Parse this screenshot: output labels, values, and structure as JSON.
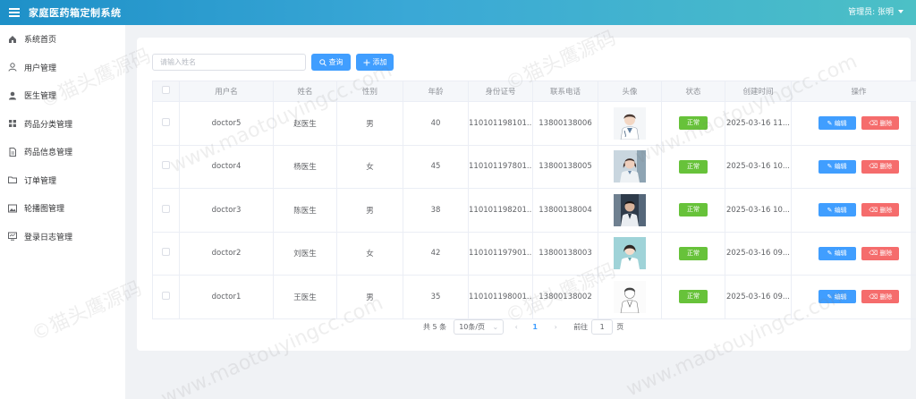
{
  "header": {
    "title": "家庭医药箱定制系统",
    "user_label": "管理员: 张明"
  },
  "sidebar": {
    "items": [
      {
        "label": "系统首页",
        "icon": "home-icon"
      },
      {
        "label": "用户管理",
        "icon": "user-outline-icon"
      },
      {
        "label": "医生管理",
        "icon": "user-filled-icon"
      },
      {
        "label": "药品分类管理",
        "icon": "grid-icon"
      },
      {
        "label": "药品信息管理",
        "icon": "document-icon"
      },
      {
        "label": "订单管理",
        "icon": "folder-icon"
      },
      {
        "label": "轮播图管理",
        "icon": "picture-icon"
      },
      {
        "label": "登录日志管理",
        "icon": "monitor-icon"
      }
    ]
  },
  "toolbar": {
    "search_placeholder": "请输入姓名",
    "query_label": "查询",
    "add_label": "添加"
  },
  "table": {
    "columns": [
      "用户名",
      "姓名",
      "性别",
      "年龄",
      "身份证号",
      "联系电话",
      "头像",
      "状态",
      "创建时间",
      "操作"
    ],
    "edit_label": "编辑",
    "delete_label": "删除",
    "rows": [
      {
        "username": "doctor5",
        "name": "赵医生",
        "gender": "男",
        "age": "40",
        "id_card": "110101198101...",
        "phone": "13800138006",
        "avatar": "male-doctor-cartoon",
        "status": "正常",
        "created": "2025-03-16 11..."
      },
      {
        "username": "doctor4",
        "name": "杨医生",
        "gender": "女",
        "age": "45",
        "id_card": "110101197801...",
        "phone": "13800138005",
        "avatar": "female-doctor-photo",
        "status": "正常",
        "created": "2025-03-16 10..."
      },
      {
        "username": "doctor3",
        "name": "陈医生",
        "gender": "男",
        "age": "38",
        "id_card": "110101198201...",
        "phone": "13800138004",
        "avatar": "male-doctor-photo",
        "status": "正常",
        "created": "2025-03-16 10..."
      },
      {
        "username": "doctor2",
        "name": "刘医生",
        "gender": "女",
        "age": "42",
        "id_card": "110101197901...",
        "phone": "13800138003",
        "avatar": "female-doctor-cartoon",
        "status": "正常",
        "created": "2025-03-16 09..."
      },
      {
        "username": "doctor1",
        "name": "王医生",
        "gender": "男",
        "age": "35",
        "id_card": "110101198001...",
        "phone": "13800138002",
        "avatar": "male-doctor-sketch",
        "status": "正常",
        "created": "2025-03-16 09..."
      }
    ]
  },
  "pagination": {
    "total_text": "共 5 条",
    "page_size": "10条/页",
    "current_page": "1",
    "goto_prefix": "前往",
    "goto_value": "1",
    "goto_suffix": "页"
  },
  "watermark": {
    "text_cn": "©猫头鹰源码",
    "text_url": "www.maotouyingcc.com"
  },
  "colors": {
    "header_start": "#1e90c8",
    "header_end": "#4cc0c6",
    "primary": "#409eff",
    "success": "#67c23a",
    "danger": "#f56c6c"
  }
}
